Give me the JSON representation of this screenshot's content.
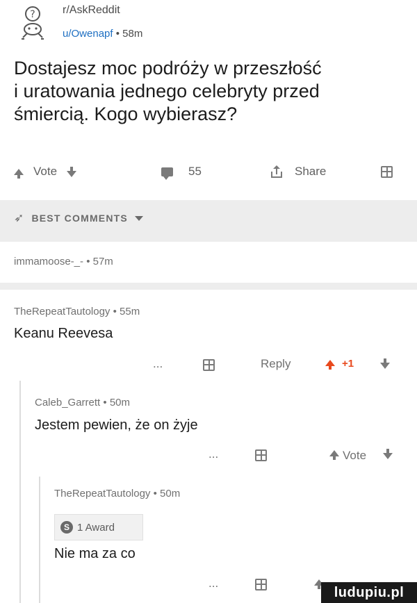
{
  "header": {
    "subreddit": "r/AskReddit",
    "user": "u/Owenapf",
    "separator": " • ",
    "time": "58m"
  },
  "post": {
    "title": "Dostajesz moc podróży w przeszłość\ni uratowania jednego celebryty przed\nśmiercią. Kogo wybierasz?"
  },
  "post_actions": {
    "vote_label": "Vote",
    "comment_count": "55",
    "share_label": "Share"
  },
  "best_comments": {
    "label": "BEST COMMENTS"
  },
  "comments": [
    {
      "author": "immamoose-_-",
      "time": "57m",
      "collapsed": true
    },
    {
      "author": "TheRepeatTautology",
      "time": "55m",
      "text": "Keanu Reevesa",
      "more": "...",
      "reply_label": "Reply",
      "score": "+1"
    },
    {
      "author": "Caleb_Garrett",
      "time": "50m",
      "text": "Jestem pewien, że on żyje",
      "more": "...",
      "vote_label": "Vote"
    },
    {
      "author": "TheRepeatTautology",
      "time": "50m",
      "award": "1 Award",
      "text": "Nie ma za co",
      "more": "..."
    }
  ],
  "icons": {
    "subreddit": "snoo-question-icon",
    "upvote": "upvote-arrow-icon",
    "downvote": "downvote-arrow-icon",
    "comments": "comment-bubble-icon",
    "share": "share-icon",
    "gift": "gift-icon",
    "best": "rocket-icon",
    "reply": "reply-arrow-icon",
    "coin": "coin-icon"
  },
  "colors": {
    "upvote_active": "#e8491d",
    "link": "#1e6fc2",
    "band": "#ededed"
  },
  "watermark": "ludupiu.pl"
}
